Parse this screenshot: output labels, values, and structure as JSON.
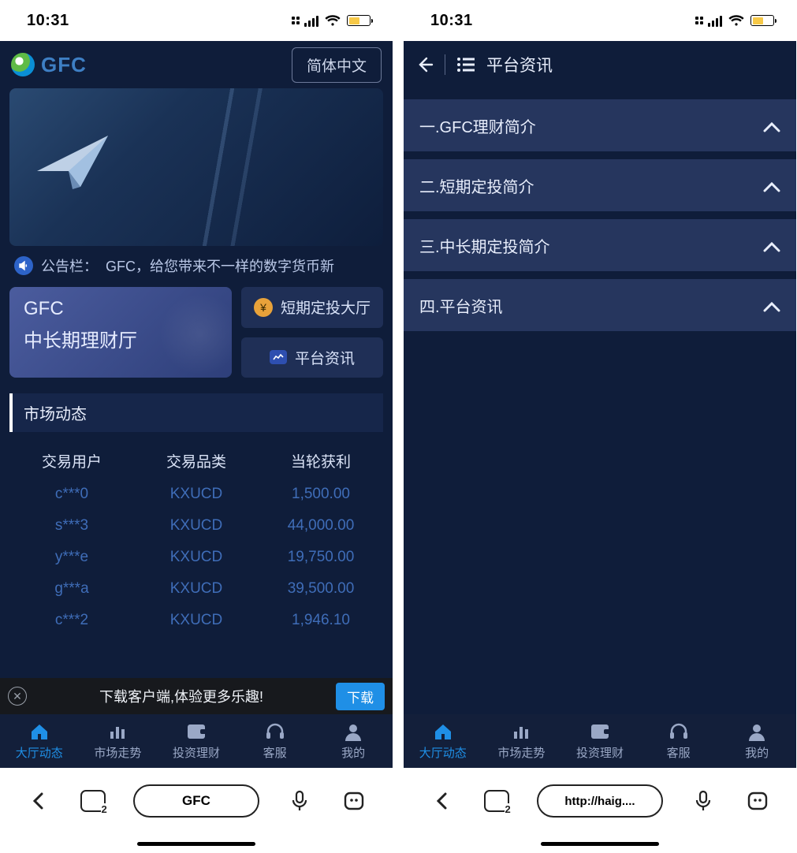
{
  "status": {
    "time": "10:31"
  },
  "left": {
    "logo_text": "GFC",
    "lang_button": "简体中文",
    "announce_prefix": "公告栏：",
    "announce_text": "GFC，给您带来不一样的数字货币新",
    "big_tile_line1": "GFC",
    "big_tile_line2": "中长期理财厅",
    "small_tile_1": "短期定投大厅",
    "small_tile_2": "平台资讯",
    "section_header": "市场动态",
    "table_headers": {
      "c0": "交易用户",
      "c1": "交易品类",
      "c2": "当轮获利"
    },
    "rows": [
      {
        "user": "c***0",
        "prod": "KXUCD",
        "profit": "1,500.00"
      },
      {
        "user": "s***3",
        "prod": "KXUCD",
        "profit": "44,000.00"
      },
      {
        "user": "y***e",
        "prod": "KXUCD",
        "profit": "19,750.00"
      },
      {
        "user": "g***a",
        "prod": "KXUCD",
        "profit": "39,500.00"
      },
      {
        "user": "c***2",
        "prod": "KXUCD",
        "profit": "1,946.10"
      }
    ],
    "download_text": "下载客户端,体验更多乐趣!",
    "download_btn": "下载",
    "nav": [
      "大厅动态",
      "市场走势",
      "投资理财",
      "客服",
      "我的"
    ],
    "browser_url": "GFC",
    "tab_count": "2"
  },
  "right": {
    "title": "平台资讯",
    "items": [
      "一.GFC理财简介",
      "二.短期定投简介",
      "三.中长期定投简介",
      "四.平台资讯"
    ],
    "nav": [
      "大厅动态",
      "市场走势",
      "投资理财",
      "客服",
      "我的"
    ],
    "browser_url": "http://haig....",
    "tab_count": "2"
  }
}
